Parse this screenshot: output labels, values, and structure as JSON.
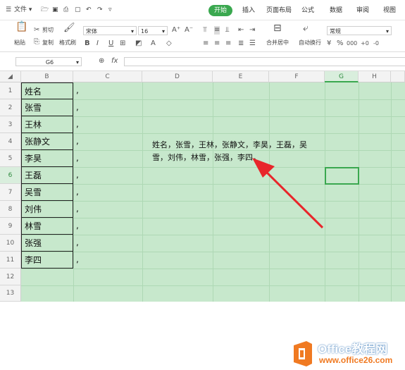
{
  "menu": {
    "file_label": "文件",
    "file_arrow": "▾"
  },
  "tabs": [
    {
      "label": "开始",
      "active": true
    },
    {
      "label": "插入",
      "active": false
    },
    {
      "label": "页面布局",
      "active": false
    },
    {
      "label": "公式",
      "active": false
    },
    {
      "label": "数据",
      "active": false
    },
    {
      "label": "审阅",
      "active": false
    },
    {
      "label": "视图",
      "active": false
    }
  ],
  "ribbon": {
    "paste_label": "粘贴",
    "cut_label": "剪切",
    "copy_label": "复制",
    "format_painter_label": "格式刷",
    "font_name": "宋体",
    "font_size": "16",
    "merge_label": "合并居中",
    "wrap_label": "自动换行",
    "number_format": "常规"
  },
  "formula_bar": {
    "cell_ref": "G6",
    "fx_label": "fx",
    "value": ""
  },
  "columns": [
    {
      "label": "",
      "sel": false
    },
    {
      "label": "B",
      "sel": false
    },
    {
      "label": "C",
      "sel": false
    },
    {
      "label": "D",
      "sel": false
    },
    {
      "label": "E",
      "sel": false
    },
    {
      "label": "F",
      "sel": false
    },
    {
      "label": "G",
      "sel": true
    },
    {
      "label": "H",
      "sel": false
    }
  ],
  "rows": [
    "1",
    "2",
    "3",
    "4",
    "5",
    "6",
    "7",
    "8",
    "9",
    "10",
    "11",
    "12",
    "13"
  ],
  "selected_row": "6",
  "names": [
    "姓名",
    "张雪",
    "王林",
    "张静文",
    "李昊",
    "王磊",
    "吴雪",
    "刘伟",
    "林雪",
    "张强",
    "李四"
  ],
  "comma": ",",
  "textbox_text": "姓名，张雪，王林，张静文，李昊，王磊，吴雪，刘伟，林雪，张强，李四，",
  "watermark": {
    "title": "Office教程网",
    "url": "www.office26.com"
  },
  "colors": {
    "accent": "#3aa84f",
    "sheet_bg": "#c7e8cc",
    "arrow": "#e8262b",
    "logo_orange": "#f07a22"
  }
}
